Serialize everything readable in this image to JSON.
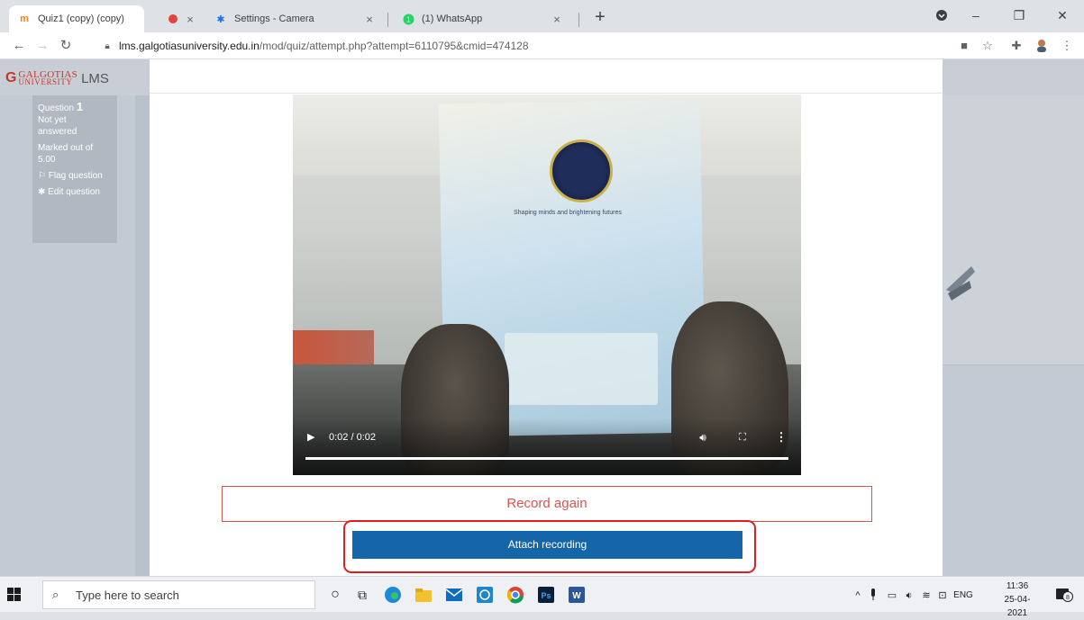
{
  "browser": {
    "tabs": [
      {
        "title": "Quiz1 (copy) (copy)",
        "favicon": "moodle-icon",
        "close": "×"
      },
      {
        "title": "",
        "favicon": "recording-dot-icon",
        "close": "×"
      },
      {
        "title": "Settings - Camera",
        "favicon": "gear-icon",
        "close": "×"
      },
      {
        "title": "(1) WhatsApp",
        "favicon": "whatsapp-icon",
        "close": "×"
      }
    ],
    "new_tab": "+",
    "window_controls": {
      "minimize": "–",
      "maximize": "❐",
      "close": "✕"
    },
    "url_host": "lms.galgotiasuniversity.edu.in",
    "url_path": "/mod/quiz/attempt.php?attempt=6110795&cmid=474128"
  },
  "lms": {
    "logo_main": "GALGOTIAS",
    "logo_sub": "UNIVERSITY",
    "logo_suffix": "LMS",
    "question_label": "Question",
    "question_number": "1",
    "status": "Not yet answered",
    "marked_label": "Marked out of",
    "marked_value": "5.00",
    "flag_label": "Flag question",
    "edit_label": "Edit question"
  },
  "recorder": {
    "time": "0:02 / 0:02",
    "progress": 1.0,
    "book_tagline": "Shaping minds and brightening futures",
    "book_logo_text": "GNW SCHOOL",
    "record_again_label": "Record again",
    "attach_label": "Attach recording"
  },
  "taskbar": {
    "search_placeholder": "Type here to search",
    "language": "ENG",
    "time": "11:36",
    "date": "25-04-2021",
    "notification_count": "8"
  },
  "colors": {
    "accent": "#1565a9",
    "danger": "#d9534f",
    "highlight": "#e11d1d"
  }
}
